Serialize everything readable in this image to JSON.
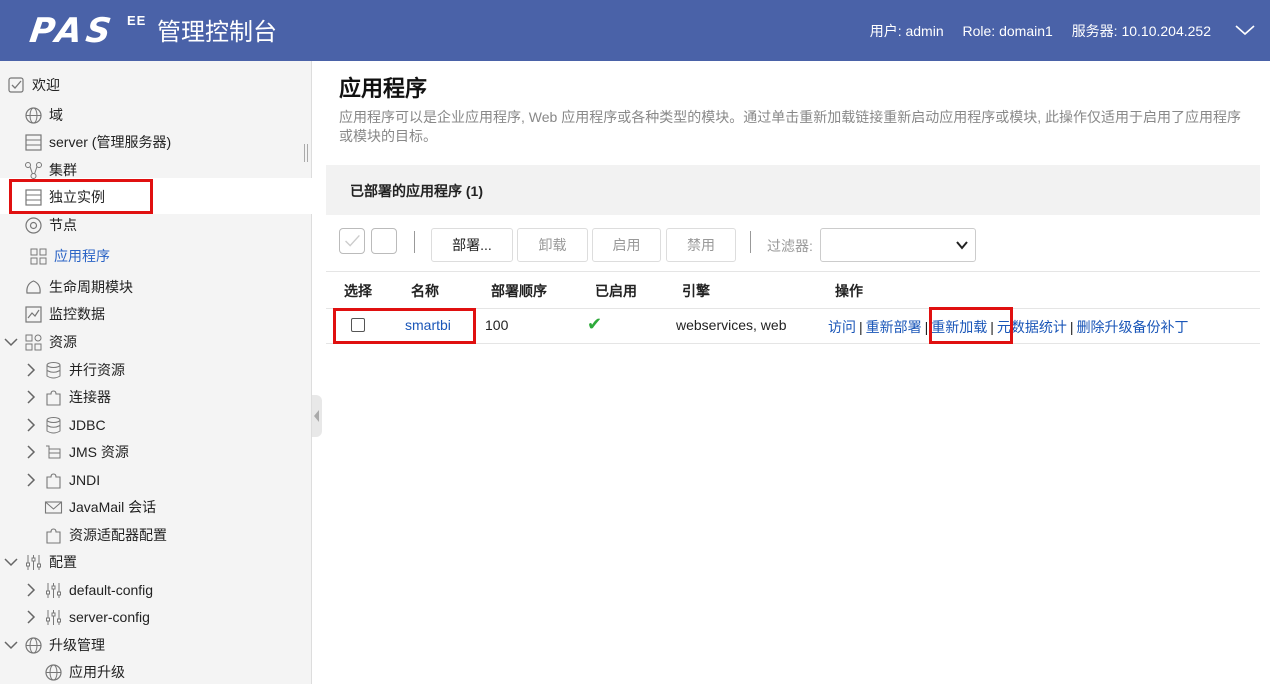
{
  "header": {
    "logo_text": "PAS",
    "logo_sup": "EE",
    "console_title": "管理控制台",
    "user": "用户: admin",
    "role": "Role: domain1",
    "server": "服务器: 10.10.204.252"
  },
  "sidebar": {
    "items": [
      {
        "label": "欢迎",
        "icon": "checkbox-icon"
      },
      {
        "label": "域",
        "icon": "globe-icon"
      },
      {
        "label": "server (管理服务器)",
        "icon": "server-icon"
      },
      {
        "label": "集群",
        "icon": "cluster-icon"
      },
      {
        "label": "独立实例",
        "icon": "server-icon"
      },
      {
        "label": "节点",
        "icon": "node-icon"
      },
      {
        "label": "应用程序",
        "icon": "apps-grid-icon"
      },
      {
        "label": "生命周期模块",
        "icon": "lifecycle-icon"
      },
      {
        "label": "监控数据",
        "icon": "monitor-chart-icon"
      },
      {
        "label": "资源",
        "icon": "resources-icon"
      },
      {
        "label": "并行资源",
        "icon": "database-icon"
      },
      {
        "label": "连接器",
        "icon": "puzzle-icon"
      },
      {
        "label": "JDBC",
        "icon": "database-icon"
      },
      {
        "label": "JMS 资源",
        "icon": "jms-icon"
      },
      {
        "label": "JNDI",
        "icon": "puzzle-icon"
      },
      {
        "label": "JavaMail 会话",
        "icon": "mail-icon"
      },
      {
        "label": "资源适配器配置",
        "icon": "puzzle-icon"
      },
      {
        "label": "配置",
        "icon": "sliders-icon"
      },
      {
        "label": "default-config",
        "icon": "sliders-icon"
      },
      {
        "label": "server-config",
        "icon": "sliders-icon"
      },
      {
        "label": "升级管理",
        "icon": "globe-icon"
      },
      {
        "label": "应用升级",
        "icon": "globe-icon"
      }
    ]
  },
  "main": {
    "title": "应用程序",
    "description": "应用程序可以是企业应用程序, Web 应用程序或各种类型的模块。通过单击重新加载链接重新启动应用程序或模块, 此操作仅适用于启用了应用程序或模块的目标。",
    "panel_title": "已部署的应用程序 (1)",
    "toolbar": {
      "deploy": "部署...",
      "undeploy": "卸载",
      "enable": "启用",
      "disable": "禁用",
      "filter_label": "过滤器:"
    },
    "table": {
      "headers": [
        "选择",
        "名称",
        "部署顺序",
        "已启用",
        "引擎",
        "操作"
      ],
      "rows": [
        {
          "name": "smartbi",
          "order": "100",
          "enabled": "✔",
          "engine": "webservices, web",
          "actions": [
            "访问",
            "重新部署",
            "重新加载",
            "元数据统计",
            "删除升级备份补丁"
          ]
        }
      ]
    }
  },
  "colors": {
    "header_bg": "#4a62a8",
    "link": "#1a56b8",
    "active_nav": "#2b64c6",
    "highlight_box": "#e01010",
    "enabled_check": "#2eaa3a"
  }
}
